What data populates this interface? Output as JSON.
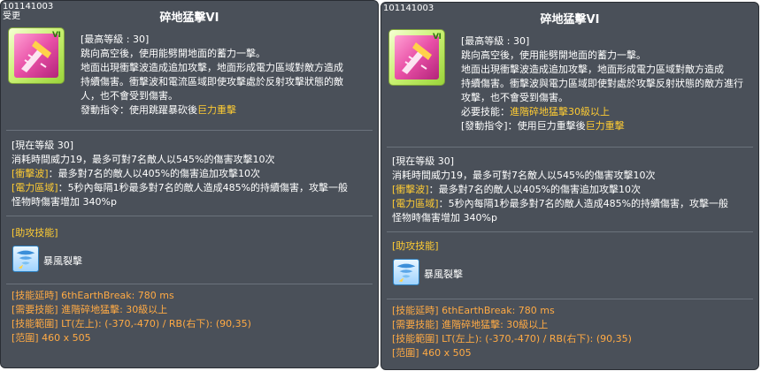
{
  "colors": {
    "panel_bg": "#4a5059",
    "highlight": "#ffcc33",
    "footer": "#ffaa44"
  },
  "left": {
    "skill_id": "101141003",
    "status_tag": "受更",
    "title": "碎地猛擊VI",
    "desc": {
      "max_level": "[最高等級 : 30]",
      "line1": "跳向高空後，使用能劈開地面的蓄力一擊。",
      "line2": "地面出現衝擊波造成追加攻擊，地面形成電力區域對敵方造成",
      "line3": "持續傷害。衝擊波和電流區域即使攻擊處於反射攻擊狀態的敵",
      "line4": "人，也不會受到傷害。",
      "cmd_prefix": "發動指令：使用跳躍暴砍後",
      "cmd_highlight": "巨力重擊"
    },
    "current": {
      "header": "[現在等級 30]",
      "line1": "消耗時間威力19，最多可對7名敵人以545%的傷害攻擊10次",
      "shock_tag": "[衝擊波]",
      "shock_text": "：最多對7名的敵人以405%的傷害追加攻擊10次",
      "elec_tag": "[電力區域]",
      "elec_text": "：5秒內每隔1秒最多對7名的敵人造成485%的持續傷害，攻擊一般",
      "elec_line2": "怪物時傷害增加 340%p"
    },
    "assist": {
      "label": "[助攻技能]",
      "name": "暴風裂擊"
    },
    "footer": {
      "delay": "[技能延時] 6thEarthBreak: 780 ms",
      "required": "[需要技能] 進階碎地猛擊: 30級以上",
      "range": "[技能範圍] LT(左上): (-370,-470) / RB(右下): (90,35)",
      "area": "[范圍] 460 x 505"
    }
  },
  "right": {
    "skill_id": "101141003",
    "title": "碎地猛擊VI",
    "desc": {
      "max_level": "[最高等級 : 30]",
      "line1": "跳向高空後，使用能劈開地面的蓄力一擊。",
      "line2": "地面出現衝擊波造成追加攻擊，地面形成電力區域對敵方造成",
      "line3": "持續傷害。衝擊波與電力區域即使對處於攻擊反射狀態的敵方進行",
      "line4": "攻擊，也不會受到傷害。",
      "req_prefix": "必要技能：",
      "req_highlight": "進階碎地猛擊30級以上",
      "cmd_prefix": "[發動指令]：使用巨力重擊後",
      "cmd_highlight": "巨力重擊"
    },
    "current": {
      "header": "[現在等級 30]",
      "line1": "消耗時間威力19，最多可對7名敵人以545%的傷害攻擊10次",
      "shock_tag": "[衝擊波]",
      "shock_text": "：最多對7名的敵人以405%的傷害追加攻擊10次",
      "elec_tag": "[電力區域]",
      "elec_text": "：5秒內每隔1秒最多對7名的敵人造成485%的持續傷害，攻擊一般",
      "elec_line2": "怪物時傷害增加 340%p"
    },
    "assist": {
      "label": "[助攻技能]",
      "name": "暴風裂擊"
    },
    "footer": {
      "delay": "[技能延時] 6thEarthBreak: 780 ms",
      "required": "[需要技能] 進階碎地猛擊: 30級以上",
      "range": "[技能範圍] LT(左上): (-370,-470) / RB(右下): (90,35)",
      "area": "[范圍] 460 x 505"
    }
  }
}
